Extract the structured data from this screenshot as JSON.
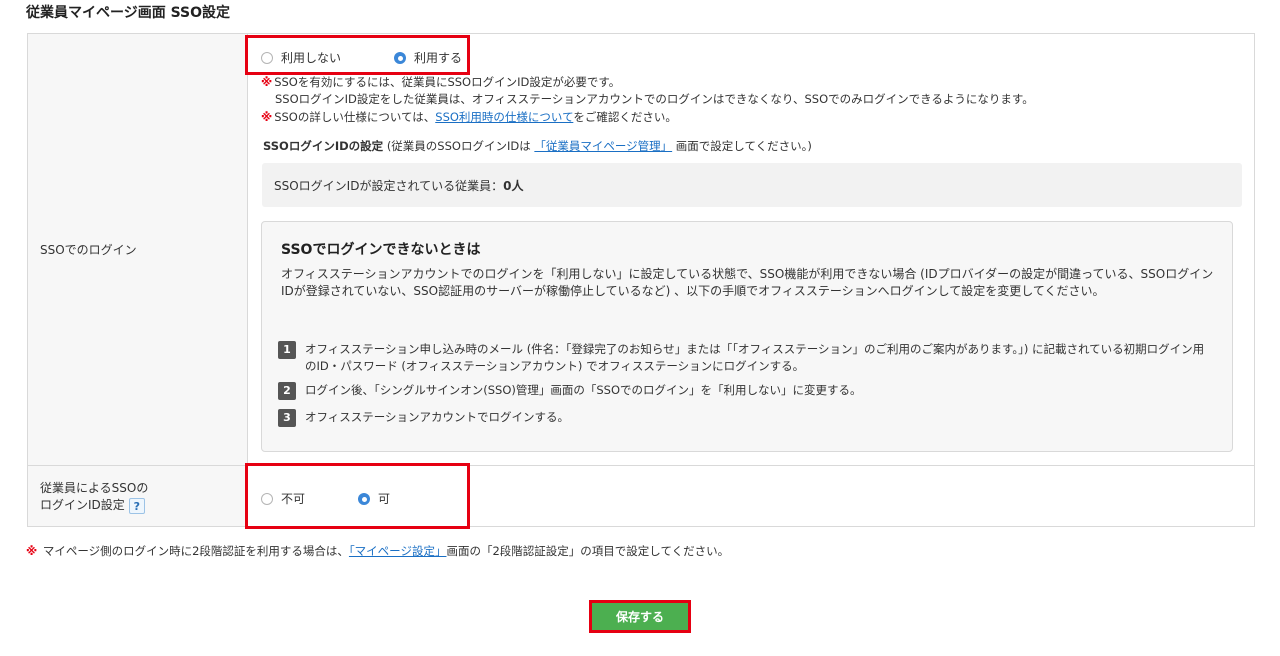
{
  "page_title": "従業員マイページ画面 SSO設定",
  "sso_login": {
    "label": "SSOでのログイン",
    "options": [
      "利用しない",
      "利用する"
    ],
    "selected": "利用する",
    "note1_line1": "SSOを有効にするには、従業員にSSOログインID設定が必要です。",
    "note1_line2": "SSOログインID設定をした従業員は、オフィスステーションアカウントでのログインはできなくなり、SSOでのみログインできるようになります。",
    "note2_prefix": "SSOの詳しい仕様については、",
    "note2_link": "SSO利用時の仕様について",
    "note2_suffix": "をご確認ください。",
    "mark": "※",
    "id_setting_heading": "SSOログインIDの設定",
    "id_setting_note_prefix": "(従業員のSSOログインIDは",
    "id_setting_link": "「従業員マイページ管理」",
    "id_setting_note_suffix": "画面で設定してください。)",
    "count_label": "SSOログインIDが設定されている従業員：",
    "count_value": "0人",
    "info": {
      "title": "SSOでログインできないときは",
      "description": "オフィスステーションアカウントでのログインを「利用しない」に設定している状態で、SSO機能が利用できない場合 (IDプロバイダーの設定が間違っている、SSOログインIDが登録されていない、SSO認証用のサーバーが稼働停止しているなど) 、以下の手順でオフィスステーションへログインして設定を変更してください。",
      "steps": [
        {
          "num": "1",
          "text": "オフィスステーション申し込み時のメール (件名：「登録完了のお知らせ」または「「オフィスステーション」のご利用のご案内があります。」) に記載されている初期ログイン用のID・パスワード (オフィスステーションアカウント) でオフィスステーションにログインする。"
        },
        {
          "num": "2",
          "text": "ログイン後、「シングルサインオン(SSO)管理」画面の「SSOでのログイン」を「利用しない」に変更する。"
        },
        {
          "num": "3",
          "text": "オフィスステーションアカウントでログインする。"
        }
      ]
    }
  },
  "employee_setting": {
    "label_line1": "従業員によるSSOの",
    "label_line2": "ログインID設定",
    "help": "?",
    "options": [
      "不可",
      "可"
    ],
    "selected": "可"
  },
  "footnote": {
    "mark": "※",
    "prefix": "マイページ側のログイン時に2段階認証を利用する場合は、",
    "link": "「マイページ設定」",
    "suffix": "画面の「2段階認証設定」の項目で設定してください。"
  },
  "save_label": "保存する",
  "colors": {
    "accent": "#3b87d8",
    "highlight": "#e60012",
    "save_button": "#4caf50",
    "link": "#1a6fc4"
  }
}
